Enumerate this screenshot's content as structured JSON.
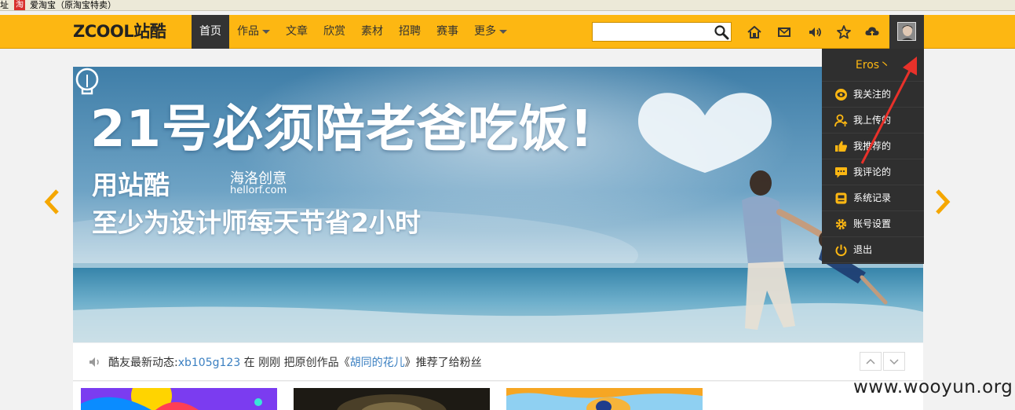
{
  "browser": {
    "bookmark_prefix": "址",
    "bookmark_icon_text": "淘",
    "bookmark_label": "爱淘宝（原淘宝特卖）"
  },
  "header": {
    "logo_text": "ZCOOL站酷",
    "nav": [
      {
        "label": "首页",
        "active": true,
        "caret": false
      },
      {
        "label": "作品",
        "active": false,
        "caret": true
      },
      {
        "label": "文章",
        "active": false,
        "caret": false
      },
      {
        "label": "欣赏",
        "active": false,
        "caret": false
      },
      {
        "label": "素材",
        "active": false,
        "caret": false
      },
      {
        "label": "招聘",
        "active": false,
        "caret": false
      },
      {
        "label": "赛事",
        "active": false,
        "caret": false
      },
      {
        "label": "更多",
        "active": false,
        "caret": true
      }
    ],
    "search_value": "",
    "icons": [
      "home-icon",
      "mail-icon",
      "speaker-icon",
      "star-icon",
      "upload-icon"
    ]
  },
  "banner": {
    "headline": "21号必须陪老爸吃饭!",
    "subline1": "用站酷",
    "brand_name": "海洛创意",
    "brand_url": "hellorf.com",
    "subline2": "至少为设计师每天节省2小时"
  },
  "user_menu": {
    "username": "Eros丶",
    "items": [
      {
        "label": "我关注的",
        "icon": "eye-icon"
      },
      {
        "label": "我上传的",
        "icon": "user-upload-icon"
      },
      {
        "label": "我推荐的",
        "icon": "thumbs-up-icon"
      },
      {
        "label": "我评论的",
        "icon": "comment-icon"
      },
      {
        "label": "系统记录",
        "icon": "record-icon"
      },
      {
        "label": "账号设置",
        "icon": "gear-icon"
      },
      {
        "label": "退出",
        "icon": "power-icon"
      }
    ]
  },
  "feed": {
    "prefix": "酷友最新动态:",
    "user": "xb105g123",
    "middle": " 在 刚刚 把原创作品《",
    "work": "胡同的花儿",
    "suffix": "》推荐了给粉丝"
  },
  "watermark": "www.wooyun.org",
  "colors": {
    "brand_yellow": "#fdb712",
    "dark": "#333333",
    "link": "#3a7fc1",
    "annotation": "#e8312a"
  }
}
